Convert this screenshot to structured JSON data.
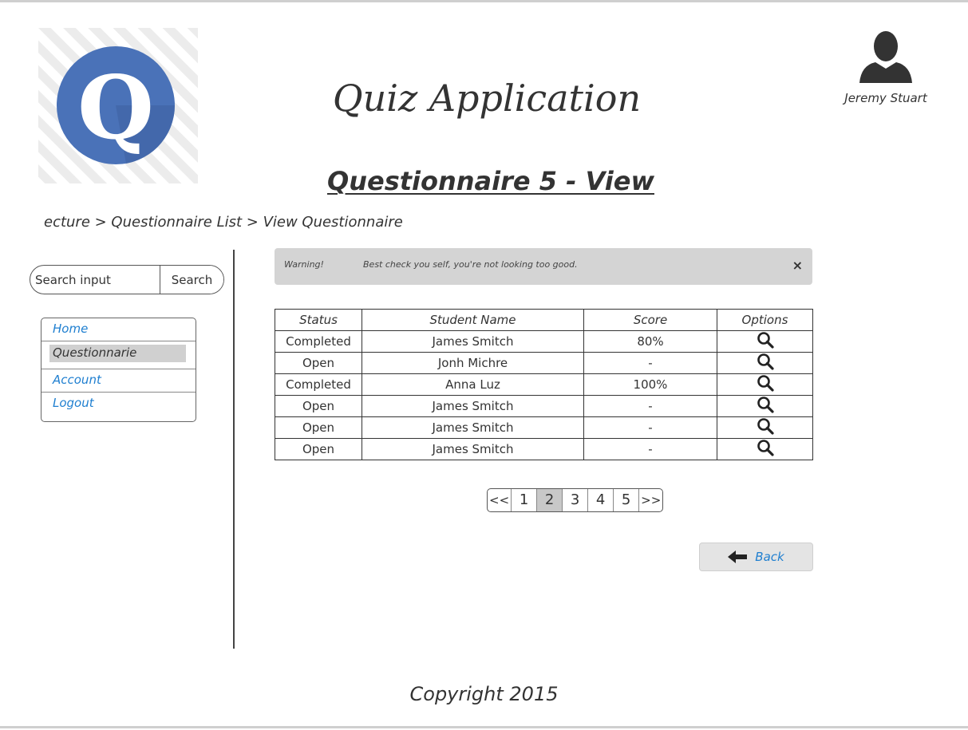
{
  "header": {
    "app_title": "Quiz Application",
    "page_title": "Questionnaire 5 - View",
    "logo_letter": "Q",
    "logo_color": "#4a72b8",
    "user_name": "Jeremy Stuart"
  },
  "breadcrumb": "ecture > Questionnaire List > View Questionnaire",
  "search": {
    "placeholder": "Search input",
    "button_label": "Search"
  },
  "nav": {
    "items": [
      {
        "label": "Home"
      },
      {
        "label": "Questionnarie",
        "active": true
      },
      {
        "label": "Account"
      },
      {
        "label": "Logout"
      }
    ]
  },
  "alert": {
    "label": "Warning!",
    "message": "Best check you self, you're not looking too good.",
    "close_symbol": "×"
  },
  "table": {
    "headers": [
      "Status",
      "Student Name",
      "Score",
      "Options"
    ],
    "rows": [
      {
        "status": "Completed",
        "name": "James Smitch",
        "score": "80%"
      },
      {
        "status": "Open",
        "name": "Jonh Michre",
        "score": "-"
      },
      {
        "status": "Completed",
        "name": "Anna Luz",
        "score": "100%"
      },
      {
        "status": "Open",
        "name": "James Smitch",
        "score": "-"
      },
      {
        "status": "Open",
        "name": "James Smitch",
        "score": "-"
      },
      {
        "status": "Open",
        "name": "James Smitch",
        "score": "-"
      }
    ],
    "option_icon": "search-icon"
  },
  "pagination": {
    "first": "<<",
    "pages": [
      "1",
      "2",
      "3",
      "4",
      "5"
    ],
    "current": "2",
    "last": ">>"
  },
  "back_button": {
    "label": "Back",
    "icon": "arrow-left-icon"
  },
  "footer": {
    "copyright": "Copyright 2015"
  },
  "colors": {
    "link": "#1f7fd0",
    "alert_bg": "#d4d4d4",
    "active_bg": "#d0d0d0"
  }
}
